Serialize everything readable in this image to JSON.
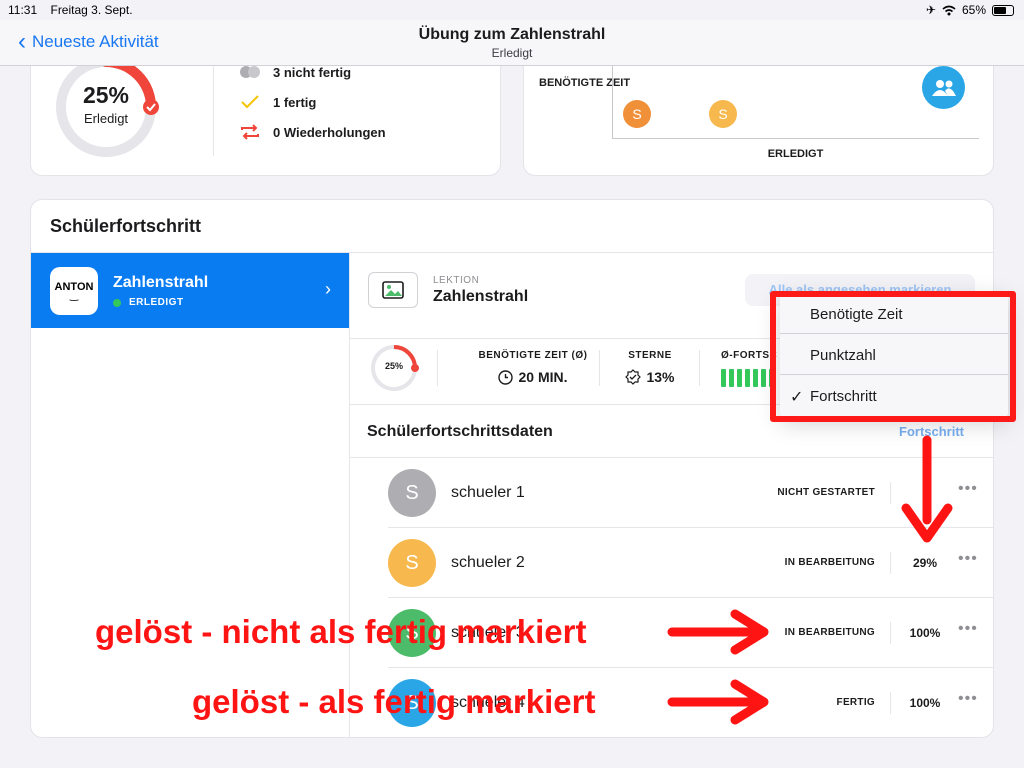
{
  "status_bar": {
    "time": "11:31",
    "date": "Freitag 3. Sept.",
    "battery": "65%"
  },
  "nav": {
    "back_label": "Neueste Aktivität",
    "title": "Übung zum Zahlenstrahl",
    "subtitle": "Erledigt"
  },
  "summary": {
    "percent": "25%",
    "percent_label": "Erledigt",
    "progress_fraction": 0.25,
    "stats": [
      {
        "icon": "people-grey-icon",
        "label": "3 nicht fertig"
      },
      {
        "icon": "checkmark-icon",
        "label": "1 fertig"
      },
      {
        "icon": "repeat-icon",
        "label": "0 Wiederholungen"
      }
    ]
  },
  "plot_card": {
    "y_label": "BENÖTIGTE ZEIT",
    "x_label": "ERLEDIGT",
    "points": [
      {
        "letter": "S",
        "color": "#f0913a"
      },
      {
        "letter": "S",
        "color": "#f7b84e"
      }
    ]
  },
  "progress_panel": {
    "title": "Schülerfortschritt",
    "sidebar_item": {
      "logo_text": "ANTON",
      "name": "Zahlenstrahl",
      "status": "ERLEDIGT"
    },
    "lesson": {
      "kicker": "LEKTION",
      "title": "Zahlenstrahl",
      "mark_button": "Alle als angesehen markieren"
    },
    "metrics": {
      "percent": "25%",
      "progress_fraction": 0.25,
      "time_label": "BENÖTIGTE ZEIT (Ø)",
      "time_value": "20 MIN.",
      "stars_label": "STERNE",
      "stars_value": "13%",
      "avg_label": "Ø-FORTSC"
    },
    "data_title": "Schülerfortschrittsdaten",
    "sort_label": "Fortschritt",
    "students": [
      {
        "initial": "S",
        "name": "schueler 1",
        "status": "NICHT GESTARTET",
        "value": "-",
        "color": "#aeaeb2"
      },
      {
        "initial": "S",
        "name": "schueler 2",
        "status": "IN BEARBEITUNG",
        "value": "29%",
        "color": "#f7b84e"
      },
      {
        "initial": "S",
        "name": "schueler 3",
        "status": "IN BEARBEITUNG",
        "value": "100%",
        "color": "#4cbb6a"
      },
      {
        "initial": "S",
        "name": "schueler 4",
        "status": "FERTIG",
        "value": "100%",
        "color": "#2aa6e6"
      }
    ]
  },
  "sort_menu": {
    "items": [
      "Benötigte Zeit",
      "Punktzahl",
      "Fortschritt"
    ],
    "selected_mark": "✓"
  },
  "annotations": {
    "line1": "gelöst - nicht als fertig markiert",
    "line2": "gelöst - als fertig markiert"
  },
  "colors": {
    "accent": "#0a7cf2",
    "annotation": "#ff1414",
    "ring": "#f0453a"
  }
}
